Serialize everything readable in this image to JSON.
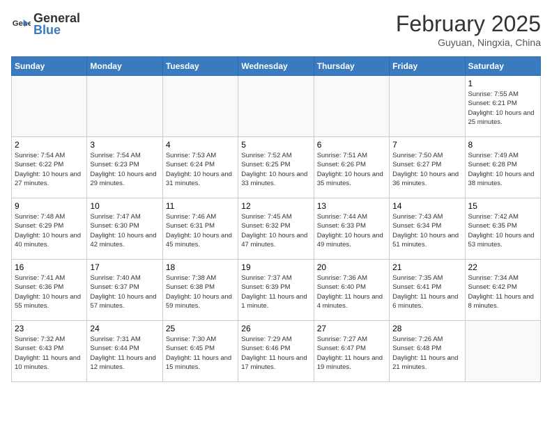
{
  "header": {
    "logo_general": "General",
    "logo_blue": "Blue",
    "month_year": "February 2025",
    "location": "Guyuan, Ningxia, China"
  },
  "weekdays": [
    "Sunday",
    "Monday",
    "Tuesday",
    "Wednesday",
    "Thursday",
    "Friday",
    "Saturday"
  ],
  "weeks": [
    [
      {
        "day": "",
        "info": ""
      },
      {
        "day": "",
        "info": ""
      },
      {
        "day": "",
        "info": ""
      },
      {
        "day": "",
        "info": ""
      },
      {
        "day": "",
        "info": ""
      },
      {
        "day": "",
        "info": ""
      },
      {
        "day": "1",
        "info": "Sunrise: 7:55 AM\nSunset: 6:21 PM\nDaylight: 10 hours and 25 minutes."
      }
    ],
    [
      {
        "day": "2",
        "info": "Sunrise: 7:54 AM\nSunset: 6:22 PM\nDaylight: 10 hours and 27 minutes."
      },
      {
        "day": "3",
        "info": "Sunrise: 7:54 AM\nSunset: 6:23 PM\nDaylight: 10 hours and 29 minutes."
      },
      {
        "day": "4",
        "info": "Sunrise: 7:53 AM\nSunset: 6:24 PM\nDaylight: 10 hours and 31 minutes."
      },
      {
        "day": "5",
        "info": "Sunrise: 7:52 AM\nSunset: 6:25 PM\nDaylight: 10 hours and 33 minutes."
      },
      {
        "day": "6",
        "info": "Sunrise: 7:51 AM\nSunset: 6:26 PM\nDaylight: 10 hours and 35 minutes."
      },
      {
        "day": "7",
        "info": "Sunrise: 7:50 AM\nSunset: 6:27 PM\nDaylight: 10 hours and 36 minutes."
      },
      {
        "day": "8",
        "info": "Sunrise: 7:49 AM\nSunset: 6:28 PM\nDaylight: 10 hours and 38 minutes."
      }
    ],
    [
      {
        "day": "9",
        "info": "Sunrise: 7:48 AM\nSunset: 6:29 PM\nDaylight: 10 hours and 40 minutes."
      },
      {
        "day": "10",
        "info": "Sunrise: 7:47 AM\nSunset: 6:30 PM\nDaylight: 10 hours and 42 minutes."
      },
      {
        "day": "11",
        "info": "Sunrise: 7:46 AM\nSunset: 6:31 PM\nDaylight: 10 hours and 45 minutes."
      },
      {
        "day": "12",
        "info": "Sunrise: 7:45 AM\nSunset: 6:32 PM\nDaylight: 10 hours and 47 minutes."
      },
      {
        "day": "13",
        "info": "Sunrise: 7:44 AM\nSunset: 6:33 PM\nDaylight: 10 hours and 49 minutes."
      },
      {
        "day": "14",
        "info": "Sunrise: 7:43 AM\nSunset: 6:34 PM\nDaylight: 10 hours and 51 minutes."
      },
      {
        "day": "15",
        "info": "Sunrise: 7:42 AM\nSunset: 6:35 PM\nDaylight: 10 hours and 53 minutes."
      }
    ],
    [
      {
        "day": "16",
        "info": "Sunrise: 7:41 AM\nSunset: 6:36 PM\nDaylight: 10 hours and 55 minutes."
      },
      {
        "day": "17",
        "info": "Sunrise: 7:40 AM\nSunset: 6:37 PM\nDaylight: 10 hours and 57 minutes."
      },
      {
        "day": "18",
        "info": "Sunrise: 7:38 AM\nSunset: 6:38 PM\nDaylight: 10 hours and 59 minutes."
      },
      {
        "day": "19",
        "info": "Sunrise: 7:37 AM\nSunset: 6:39 PM\nDaylight: 11 hours and 1 minute."
      },
      {
        "day": "20",
        "info": "Sunrise: 7:36 AM\nSunset: 6:40 PM\nDaylight: 11 hours and 4 minutes."
      },
      {
        "day": "21",
        "info": "Sunrise: 7:35 AM\nSunset: 6:41 PM\nDaylight: 11 hours and 6 minutes."
      },
      {
        "day": "22",
        "info": "Sunrise: 7:34 AM\nSunset: 6:42 PM\nDaylight: 11 hours and 8 minutes."
      }
    ],
    [
      {
        "day": "23",
        "info": "Sunrise: 7:32 AM\nSunset: 6:43 PM\nDaylight: 11 hours and 10 minutes."
      },
      {
        "day": "24",
        "info": "Sunrise: 7:31 AM\nSunset: 6:44 PM\nDaylight: 11 hours and 12 minutes."
      },
      {
        "day": "25",
        "info": "Sunrise: 7:30 AM\nSunset: 6:45 PM\nDaylight: 11 hours and 15 minutes."
      },
      {
        "day": "26",
        "info": "Sunrise: 7:29 AM\nSunset: 6:46 PM\nDaylight: 11 hours and 17 minutes."
      },
      {
        "day": "27",
        "info": "Sunrise: 7:27 AM\nSunset: 6:47 PM\nDaylight: 11 hours and 19 minutes."
      },
      {
        "day": "28",
        "info": "Sunrise: 7:26 AM\nSunset: 6:48 PM\nDaylight: 11 hours and 21 minutes."
      },
      {
        "day": "",
        "info": ""
      }
    ]
  ]
}
